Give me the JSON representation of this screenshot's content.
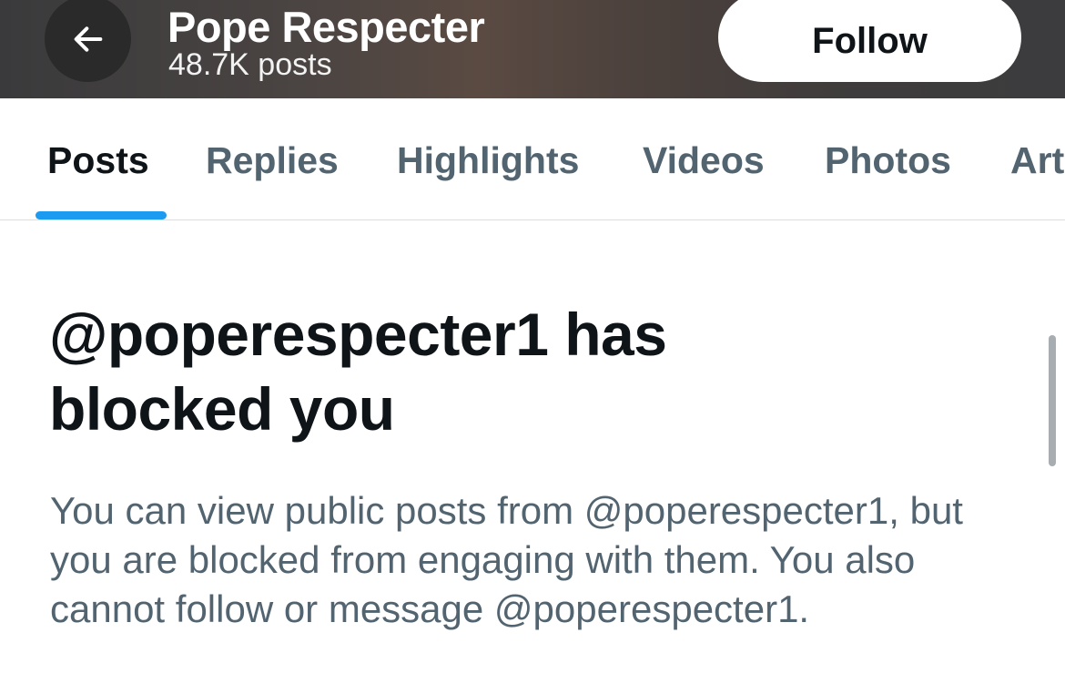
{
  "header": {
    "profile_name": "Pope Respecter",
    "post_count": "48.7K posts",
    "follow_label": "Follow"
  },
  "tabs": [
    {
      "label": "Posts",
      "active": true
    },
    {
      "label": "Replies",
      "active": false
    },
    {
      "label": "Highlights",
      "active": false
    },
    {
      "label": "Videos",
      "active": false
    },
    {
      "label": "Photos",
      "active": false
    },
    {
      "label": "Art",
      "active": false
    }
  ],
  "blocked": {
    "title": "@poperespecter1 has blocked you",
    "description": "You can view public posts from @poperespecter1, but you are blocked from engaging with them. You also cannot follow or message @poperespecter1."
  },
  "icons": {
    "back": "arrow-left-icon"
  },
  "colors": {
    "primary_text": "#0f1419",
    "secondary_text": "#536471",
    "accent": "#1d9bf0"
  }
}
